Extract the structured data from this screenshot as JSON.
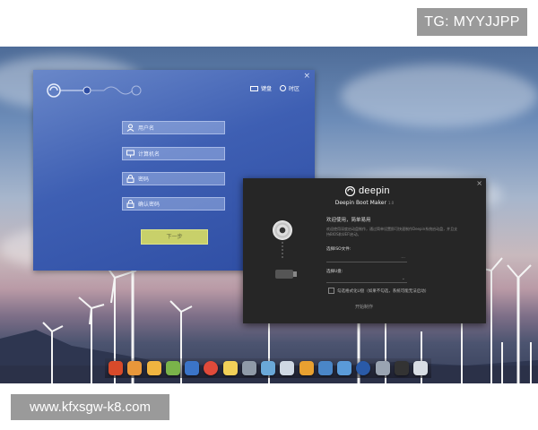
{
  "watermarks": {
    "top_right": "TG: MYYJJPP",
    "bottom_left": "www.kfxsgw-k8.com"
  },
  "installer": {
    "close_glyph": "×",
    "top_buttons": [
      "键盘",
      "时区"
    ],
    "fields": [
      {
        "placeholder": "用户名",
        "icon": "user-icon"
      },
      {
        "placeholder": "计算机名",
        "icon": "computer-icon"
      },
      {
        "placeholder": "密码",
        "icon": "lock-icon"
      },
      {
        "placeholder": "确认密码",
        "icon": "lock-icon"
      }
    ],
    "next_label": "下一步"
  },
  "bootmaker": {
    "close_glyph": "×",
    "brand": "deepin",
    "title": "Deepin Boot Maker",
    "version": "1.0",
    "welcome": "欢迎使用，简单易用",
    "description": "欢迎使用深度启动盘制作，通过简单设置即可快速制作Deepin系统启动盘，并且支持BIOS和UEFI启动。",
    "iso_label": "选择ISO文件:",
    "usb_label": "选择U盘:",
    "checkbox_label": "勾选格式化U盘（如果不勾选，系统可能无法启动）",
    "start_label": "开始制作"
  },
  "colors": {
    "installer_bg": "#3e5fb3",
    "bootmaker_bg": "#262626",
    "next_button": "#c8d06a"
  }
}
